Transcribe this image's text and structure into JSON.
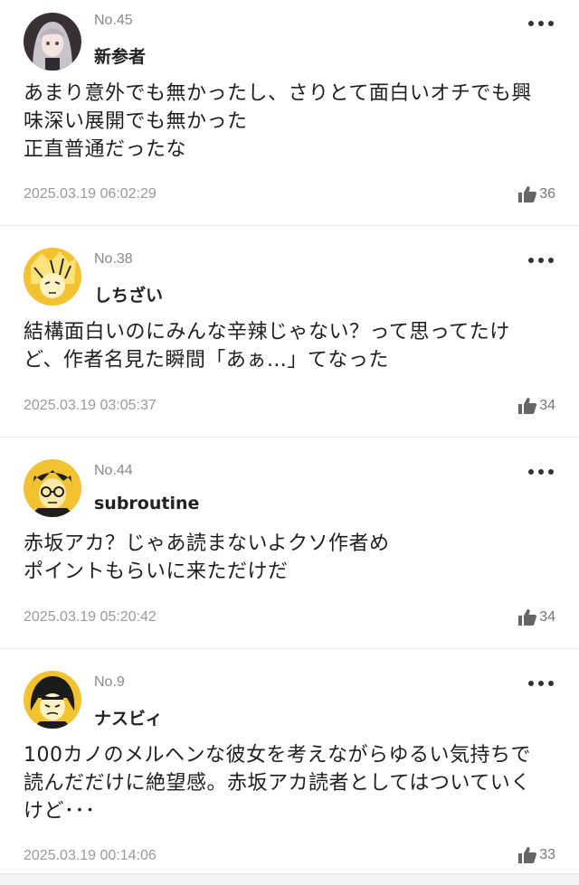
{
  "comments": [
    {
      "no": "No.45",
      "user": "新参者",
      "avatar_icon": "avatar-gray-hair-girl",
      "text": "あまり意外でも無かったし、さりとて面白いオチでも興\n味深い展開でも無かった\n正直普通だったな",
      "timestamp": "2025.03.19 06:02:29",
      "likes": "36"
    },
    {
      "no": "No.38",
      "user": "しちざい",
      "avatar_icon": "avatar-yellow-manga",
      "text": "結構面白いのにみんな辛辣じゃない？って思ってたけ\nど、作者名見た瞬間「あぁ…」てなった",
      "timestamp": "2025.03.19 03:05:37",
      "likes": "34"
    },
    {
      "no": "No.44",
      "user": "subroutine",
      "avatar_icon": "avatar-glasses-character",
      "text": "赤坂アカ？じゃあ読まないよクソ作者め\nポイントもらいに来ただけだ",
      "timestamp": "2025.03.19 05:20:42",
      "likes": "34"
    },
    {
      "no": "No.9",
      "user": "ナスビィ",
      "avatar_icon": "avatar-black-hair-character",
      "text": "100カノのメルヘンな彼女を考えながらゆるい気持ちで\n読んだだけに絶望感。赤坂アカ読者としてはついていく\nけど･･･",
      "timestamp": "2025.03.19 00:14:06",
      "likes": "33"
    }
  ],
  "colors": {
    "meta_gray": "#9a9a9a",
    "text": "#1f1f1f",
    "divider": "#ececec",
    "avatar_yellow": "#f2c230"
  }
}
